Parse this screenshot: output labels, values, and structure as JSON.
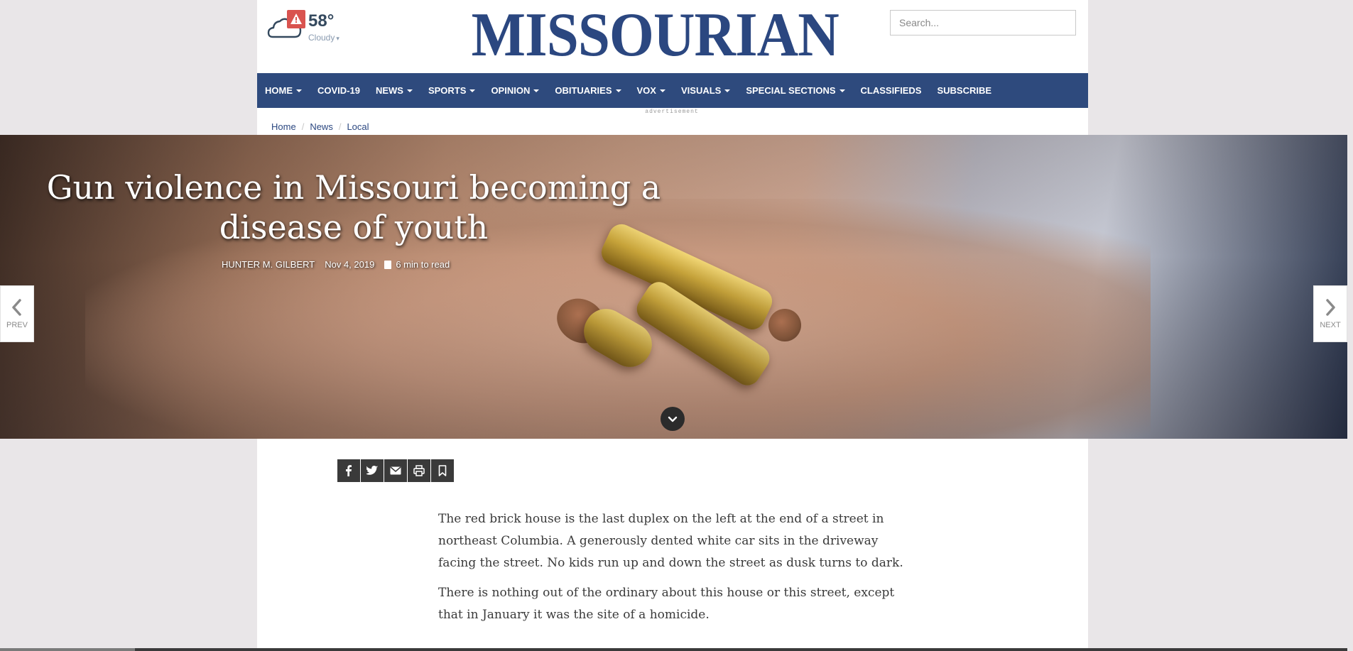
{
  "weather": {
    "temperature": "58°",
    "condition": "Cloudy",
    "alert_icon": "warning-icon",
    "icon": "partly-cloudy-night-icon"
  },
  "header": {
    "logo": "MISSOURIAN",
    "search_placeholder": "Search..."
  },
  "nav": {
    "items": [
      {
        "label": "HOME",
        "dropdown": true
      },
      {
        "label": "COVID-19",
        "dropdown": false
      },
      {
        "label": "NEWS",
        "dropdown": true
      },
      {
        "label": "SPORTS",
        "dropdown": true
      },
      {
        "label": "OPINION",
        "dropdown": true
      },
      {
        "label": "OBITUARIES",
        "dropdown": true
      },
      {
        "label": "VOX",
        "dropdown": true
      },
      {
        "label": "VISUALS",
        "dropdown": true
      },
      {
        "label": "SPECIAL SECTIONS",
        "dropdown": true
      },
      {
        "label": "CLASSIFIEDS",
        "dropdown": false
      },
      {
        "label": "SUBSCRIBE",
        "dropdown": false
      }
    ]
  },
  "ad_label": "advertisement",
  "breadcrumb": [
    "Home",
    "News",
    "Local"
  ],
  "article": {
    "headline": "Gun violence in Missouri becoming a disease of youth",
    "author": "HUNTER M. GILBERT",
    "date": "Nov 4, 2019",
    "read_time": "6 min to read",
    "paragraphs": [
      "The red brick house is the last duplex on the left at the end of a street in northeast Columbia. A generously dented white car sits in the driveway facing the street. No kids run up and down the street as dusk turns to dark.",
      "There is nothing out of the ordinary about this house or this street, except that in January it was the site of a homicide."
    ]
  },
  "pager": {
    "prev_label": "PREV",
    "next_label": "NEXT"
  },
  "share": [
    "facebook-icon",
    "twitter-icon",
    "email-icon",
    "print-icon",
    "bookmark-icon"
  ],
  "colors": {
    "brand_blue": "#2e4a7d",
    "logo_blue": "#2b4780"
  }
}
